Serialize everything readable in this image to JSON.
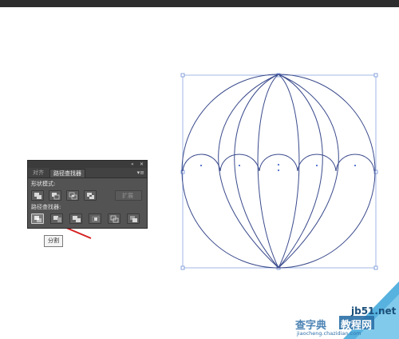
{
  "pathfinder_panel": {
    "tabs": [
      "对齐",
      "路径查找器"
    ],
    "active_tab": "路径查找器",
    "collapse_icon": "double-chevron-icon",
    "close_icon": "close-icon",
    "menu_icon": "panel-menu-icon",
    "shape_modes_label": "形状模式:",
    "shape_mode_buttons": [
      "unite-icon",
      "minus-front-icon",
      "intersect-icon",
      "exclude-icon"
    ],
    "expand_button_label": "扩展",
    "pathfinders_label": "路径查找器:",
    "pathfinder_buttons": [
      "divide-icon",
      "trim-icon",
      "merge-icon",
      "crop-icon",
      "outline-icon",
      "minus-back-icon"
    ],
    "selected_button": "divide-icon"
  },
  "tooltip": {
    "text": "分割"
  },
  "arrow": {
    "color": "#d62020"
  },
  "artwork": {
    "stroke_color": "#3a4a8c",
    "bbox_color": "#6e8fd6"
  },
  "watermark": {
    "site_text": "jb51.net",
    "brand_left": "查字典",
    "brand_right": "教程网",
    "url_text": "jiaocheng.chazidian.com",
    "accent_color": "#3aa5d9"
  }
}
